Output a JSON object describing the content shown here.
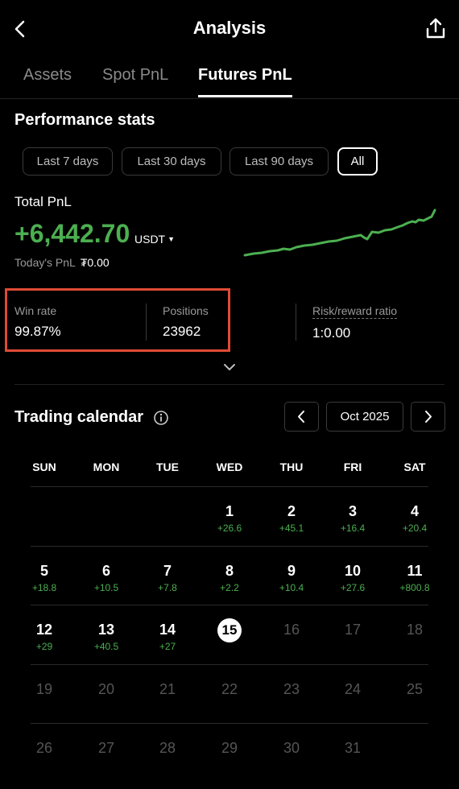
{
  "header": {
    "title": "Analysis",
    "back_icon": "chevron-left-icon",
    "share_icon": "share-icon"
  },
  "tabs": [
    {
      "label": "Assets"
    },
    {
      "label": "Spot PnL"
    },
    {
      "label": "Futures PnL",
      "active": true
    }
  ],
  "performance": {
    "title": "Performance stats",
    "ranges": [
      {
        "label": "Last 7 days"
      },
      {
        "label": "Last 30 days"
      },
      {
        "label": "Last 90 days"
      },
      {
        "label": "All",
        "active": true
      }
    ],
    "total_label": "Total PnL",
    "total_value": "+6,442.70",
    "unit": "USDT",
    "today_label": "Today's PnL",
    "today_value": "₮0.00",
    "colors": {
      "positive": "#4caf50",
      "highlight": "#e04a35"
    }
  },
  "stats": {
    "win_rate_label": "Win rate",
    "win_rate_value": "99.87%",
    "positions_label": "Positions",
    "positions_value": "23962",
    "rr_label": "Risk/reward ratio",
    "rr_value": "1:0.00"
  },
  "calendar": {
    "title": "Trading calendar",
    "month": "Oct 2025",
    "weekdays": [
      "SUN",
      "MON",
      "TUE",
      "WED",
      "THU",
      "FRI",
      "SAT"
    ],
    "days": [
      {
        "d": "1",
        "pnl": "+26.6"
      },
      {
        "d": "2",
        "pnl": "+45.1"
      },
      {
        "d": "3",
        "pnl": "+16.4"
      },
      {
        "d": "4",
        "pnl": "+20.4"
      },
      {
        "d": "5",
        "pnl": "+18.8"
      },
      {
        "d": "6",
        "pnl": "+10.5"
      },
      {
        "d": "7",
        "pnl": "+7.8"
      },
      {
        "d": "8",
        "pnl": "+2.2"
      },
      {
        "d": "9",
        "pnl": "+10.4"
      },
      {
        "d": "10",
        "pnl": "+27.6"
      },
      {
        "d": "11",
        "pnl": "+800.8"
      },
      {
        "d": "12",
        "pnl": "+29"
      },
      {
        "d": "13",
        "pnl": "+40.5"
      },
      {
        "d": "14",
        "pnl": "+27"
      },
      {
        "d": "15",
        "pnl": "",
        "today": true
      },
      {
        "d": "16",
        "pnl": ""
      },
      {
        "d": "17",
        "pnl": ""
      },
      {
        "d": "18",
        "pnl": ""
      },
      {
        "d": "19",
        "pnl": ""
      },
      {
        "d": "20",
        "pnl": ""
      },
      {
        "d": "21",
        "pnl": ""
      },
      {
        "d": "22",
        "pnl": ""
      },
      {
        "d": "23",
        "pnl": ""
      },
      {
        "d": "24",
        "pnl": ""
      },
      {
        "d": "25",
        "pnl": ""
      },
      {
        "d": "26",
        "pnl": ""
      },
      {
        "d": "27",
        "pnl": ""
      },
      {
        "d": "28",
        "pnl": ""
      },
      {
        "d": "29",
        "pnl": ""
      },
      {
        "d": "30",
        "pnl": ""
      },
      {
        "d": "31",
        "pnl": ""
      }
    ]
  }
}
